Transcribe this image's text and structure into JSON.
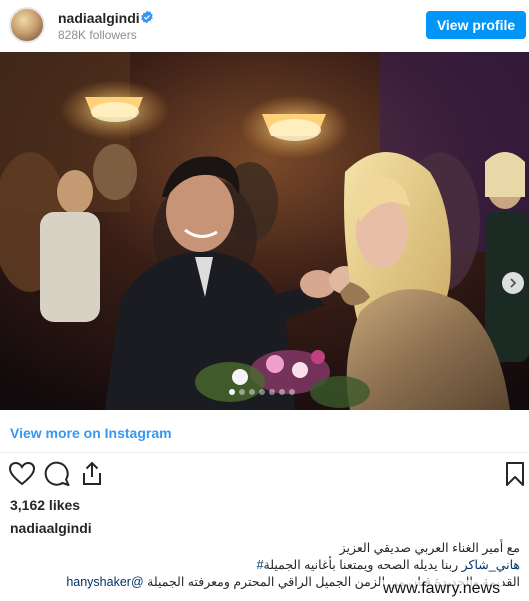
{
  "header": {
    "username": "nadiaalgindi",
    "followers": "828K followers",
    "view_profile_label": "View profile"
  },
  "carousel": {
    "count": 7,
    "active_index": 0
  },
  "view_more_label": "View more on Instagram",
  "likes": "3,162 likes",
  "caption": {
    "username": "nadiaalgindi",
    "line1": "مع أمير الغناء العربي صديقي العزيز",
    "mention_tag": "هاني_شاكر",
    "line2_rest": " ربنا يديله الصحه ويمتعنا بأغانيه الجميلة",
    "hashtag": "#",
    "line3": "القديمة والجديدة فنان من الزمن الجميل الراقي المحترم ومعرفته الجميلة",
    "handle": "@hanyshaker"
  },
  "watermark": "www.fawry.news",
  "colors": {
    "accent": "#0095f6",
    "link": "#3897f0",
    "tag": "#003569"
  }
}
